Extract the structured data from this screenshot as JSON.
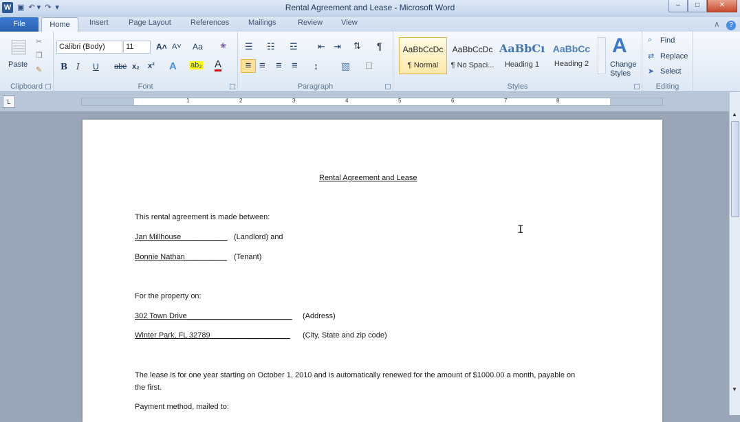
{
  "window": {
    "title": "Rental Agreement and Lease  -  Microsoft Word",
    "app_icon": "W",
    "min": "–",
    "max": "□",
    "close": "✕"
  },
  "qat": {
    "save_icon": "▣",
    "undo_icon": "↶ ▾",
    "redo_icon": "↷",
    "customize_icon": "▾"
  },
  "tabs": {
    "file": "File",
    "home": "Home",
    "insert": "Insert",
    "page_layout": "Page Layout",
    "references": "References",
    "mailings": "Mailings",
    "review": "Review",
    "view": "View",
    "help": "?",
    "minimize_icon": "∧"
  },
  "clipboard": {
    "paste": "Paste",
    "label": "Clipboard",
    "paste_icon": "▤",
    "cut_icon": "✂",
    "copy_icon": "❐",
    "format_painter_icon": "✎"
  },
  "font": {
    "name": "Calibri (Body)",
    "size": "11",
    "grow": "A˄",
    "shrink": "A˅",
    "case": "Aa",
    "clear": "❀",
    "bold": "B",
    "italic": "I",
    "underline": "U",
    "strike": "abe",
    "subscript": "x₂",
    "superscript": "x²",
    "effects": "A",
    "highlight": "ab₂",
    "color": "A",
    "label": "Font"
  },
  "paragraph": {
    "bullets": "☰",
    "numbering": "☷",
    "multilevel": "☲",
    "decrease_indent": "⇤",
    "increase_indent": "⇥",
    "sort": "⇅",
    "show_marks": "¶",
    "align_left": "≡",
    "align_center": "≡",
    "align_right": "≡",
    "justify": "≡",
    "line_spacing": "↕",
    "shading": "▧",
    "borders": "□",
    "label": "Paragraph"
  },
  "styles": {
    "items": [
      {
        "preview": "AaBbCcDc",
        "name": "¶ Normal"
      },
      {
        "preview": "AaBbCcDc",
        "name": "¶ No Spaci..."
      },
      {
        "preview": "AaBbCı",
        "name": "Heading 1"
      },
      {
        "preview": "AaBbCc",
        "name": "Heading 2"
      }
    ],
    "change": "Change",
    "change2": "Styles",
    "label": "Styles",
    "change_icon": "A"
  },
  "editing": {
    "find": "Find",
    "replace": "Replace",
    "select": "Select",
    "label": "Editing",
    "find_icon": "⌕",
    "replace_icon": "⇄",
    "select_icon": "➤"
  },
  "ruler": {
    "tab_selector": "L",
    "numbers": [
      "1",
      "2",
      "3",
      "4",
      "5",
      "6",
      "7",
      "8"
    ]
  },
  "document": {
    "title": "Rental Agreement and Lease",
    "intro": "This rental agreement is made between:",
    "landlord_name": "Jan Millhouse___________",
    "landlord_role": "(Landlord) and",
    "tenant_name": "Bonnie Nathan__________",
    "tenant_role": "(Tenant)",
    "property_intro": "For the property on:",
    "address": "302 Town Drive_________________________",
    "address_label": "(Address)",
    "city": "Winter Park, FL 32789___________________",
    "city_label": "(City, State and zip code)",
    "lease_line1": "The lease is for one year starting on October 1, 2010 and is automatically renewed for the amount of $1000.00 a month, payable on",
    "lease_line2": "the first.",
    "payment": "Payment method, mailed to:"
  },
  "cursor": "I"
}
